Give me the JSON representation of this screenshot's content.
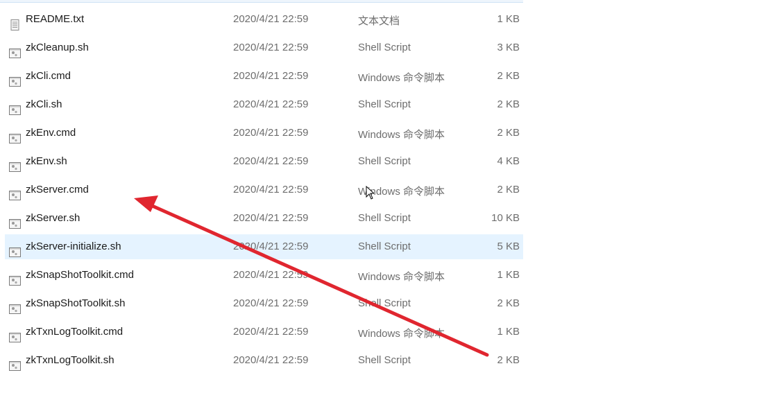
{
  "files": [
    {
      "name": "README.txt",
      "date": "2020/4/21 22:59",
      "type": "文本文档",
      "size": "1 KB",
      "icon": "text-file-icon"
    },
    {
      "name": "zkCleanup.sh",
      "date": "2020/4/21 22:59",
      "type": "Shell Script",
      "size": "3 KB",
      "icon": "script-file-icon"
    },
    {
      "name": "zkCli.cmd",
      "date": "2020/4/21 22:59",
      "type": "Windows 命令脚本",
      "size": "2 KB",
      "icon": "script-file-icon"
    },
    {
      "name": "zkCli.sh",
      "date": "2020/4/21 22:59",
      "type": "Shell Script",
      "size": "2 KB",
      "icon": "script-file-icon"
    },
    {
      "name": "zkEnv.cmd",
      "date": "2020/4/21 22:59",
      "type": "Windows 命令脚本",
      "size": "2 KB",
      "icon": "script-file-icon"
    },
    {
      "name": "zkEnv.sh",
      "date": "2020/4/21 22:59",
      "type": "Shell Script",
      "size": "4 KB",
      "icon": "script-file-icon"
    },
    {
      "name": "zkServer.cmd",
      "date": "2020/4/21 22:59",
      "type": "Windows 命令脚本",
      "size": "2 KB",
      "icon": "script-file-icon"
    },
    {
      "name": "zkServer.sh",
      "date": "2020/4/21 22:59",
      "type": "Shell Script",
      "size": "10 KB",
      "icon": "script-file-icon"
    },
    {
      "name": "zkServer-initialize.sh",
      "date": "2020/4/21 22:59",
      "type": "Shell Script",
      "size": "5 KB",
      "icon": "script-file-icon",
      "hover": true
    },
    {
      "name": "zkSnapShotToolkit.cmd",
      "date": "2020/4/21 22:59",
      "type": "Windows 命令脚本",
      "size": "1 KB",
      "icon": "script-file-icon"
    },
    {
      "name": "zkSnapShotToolkit.sh",
      "date": "2020/4/21 22:59",
      "type": "Shell Script",
      "size": "2 KB",
      "icon": "script-file-icon"
    },
    {
      "name": "zkTxnLogToolkit.cmd",
      "date": "2020/4/21 22:59",
      "type": "Windows 命令脚本",
      "size": "1 KB",
      "icon": "script-file-icon"
    },
    {
      "name": "zkTxnLogToolkit.sh",
      "date": "2020/4/21 22:59",
      "type": "Shell Script",
      "size": "2 KB",
      "icon": "script-file-icon"
    }
  ],
  "colors": {
    "hover": "#e5f3ff",
    "annotation_arrow": "#e0262f"
  }
}
